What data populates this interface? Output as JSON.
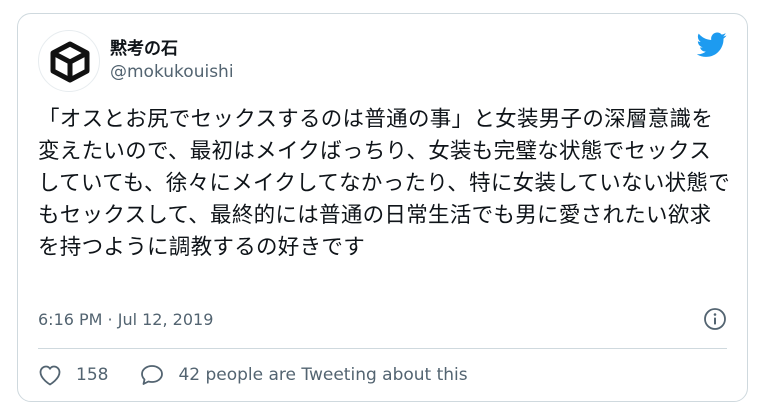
{
  "author": {
    "display_name": "黙考の石",
    "handle": "@mokukouishi",
    "avatar_icon": "cube-icon"
  },
  "brand": {
    "icon": "twitter-bird-icon",
    "color": "#1d9bf0"
  },
  "tweet": {
    "text": "「オスとお尻でセックスするのは普通の事」と女装男子の深層意識を変えたいので、最初はメイクばっちり、女装も完璧な状態でセックスしていても、徐々にメイクしてなかったり、特に女装していない状態でもセックスして、最終的には普通の日常生活でも男に愛されたい欲求を持つように調教するの好きです",
    "timestamp": "6:16 PM · Jul 12, 2019",
    "info_icon": "info-icon"
  },
  "actions": {
    "like_count": "158",
    "like_icon": "heart-icon",
    "reply_icon": "speech-bubble-icon",
    "conversation_label": "42 people are Tweeting about this"
  }
}
